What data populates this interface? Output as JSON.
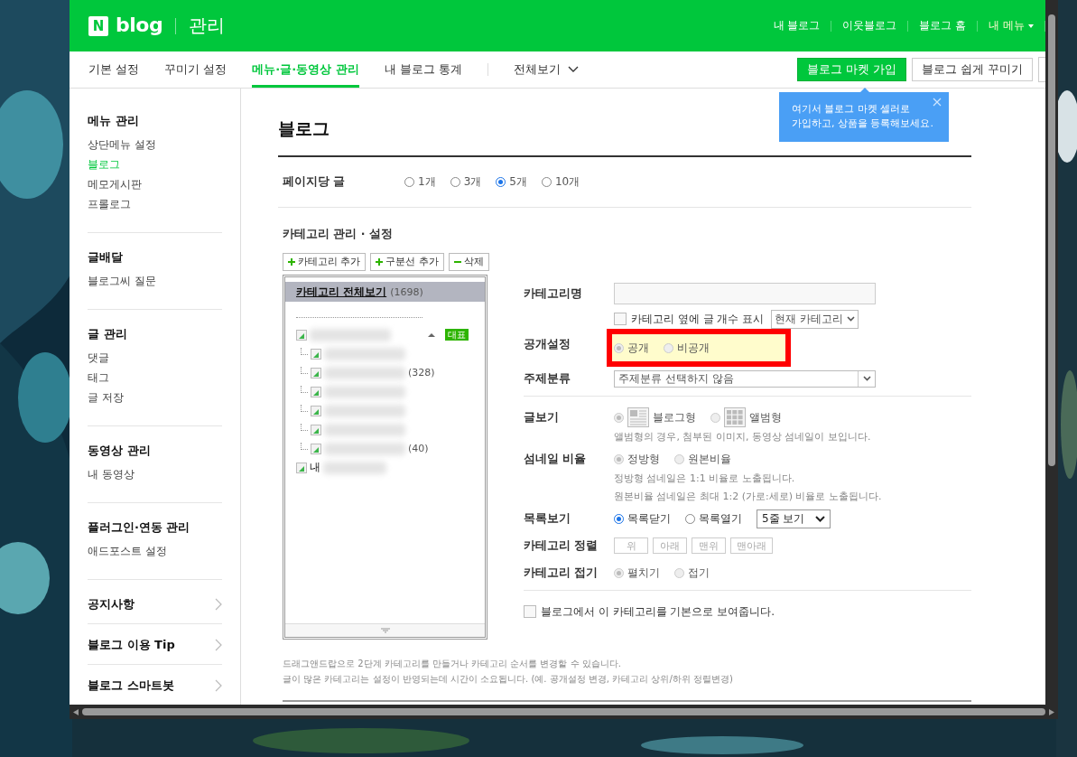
{
  "header": {
    "logo_mark": "N",
    "logo_text": "blog",
    "title": "관리",
    "links": [
      {
        "label": "내 블로그",
        "kind": "link"
      },
      {
        "label": "이웃블로그",
        "kind": "link"
      },
      {
        "label": "블로그 홈",
        "kind": "link"
      },
      {
        "label": "내 메뉴",
        "kind": "menu"
      }
    ]
  },
  "tabs": [
    {
      "label": "기본 설정",
      "selected": false,
      "kind": "tab"
    },
    {
      "label": "꾸미기 설정",
      "selected": false,
      "kind": "tab"
    },
    {
      "label": "메뉴·글·동영상 관리",
      "selected": true,
      "kind": "tab"
    },
    {
      "label": "내 블로그 통계",
      "selected": false,
      "kind": "tab"
    },
    {
      "label": "전체보기",
      "selected": false,
      "kind": "dropdown"
    }
  ],
  "actions": [
    {
      "label": "블로그 마켓 가입",
      "kind": "primary"
    },
    {
      "label": "블로그 쉽게 꾸미기",
      "kind": "outline"
    }
  ],
  "tooltip": {
    "lines": [
      "여기서 블로그 마켓 셀러로",
      "가입하고, 상품을 등록해보세요."
    ]
  },
  "sidebar": {
    "sections": [
      {
        "title": "메뉴 관리",
        "items": [
          {
            "label": "상단메뉴 설정",
            "selected": false
          },
          {
            "label": "블로그",
            "selected": true
          },
          {
            "label": "메모게시판",
            "selected": false
          },
          {
            "label": "프롤로그",
            "selected": false
          }
        ]
      },
      {
        "title": "글배달",
        "items": [
          {
            "label": "블로그씨 질문",
            "selected": false
          }
        ]
      },
      {
        "title": "글 관리",
        "items": [
          {
            "label": "댓글",
            "selected": false
          },
          {
            "label": "태그",
            "selected": false
          },
          {
            "label": "글 저장",
            "selected": false
          }
        ]
      },
      {
        "title": "동영상 관리",
        "items": [
          {
            "label": "내 동영상",
            "selected": false
          }
        ]
      },
      {
        "title": "플러그인·연동 관리",
        "items": [
          {
            "label": "애드포스트 설정",
            "selected": false
          }
        ]
      },
      {
        "title": "공지사항",
        "kind": "link"
      },
      {
        "title": "블로그 이용 Tip",
        "kind": "link"
      },
      {
        "title": "블로그 스마트봇",
        "kind": "link"
      }
    ]
  },
  "main": {
    "title": "블로그",
    "per_page": {
      "label": "페이지당 글",
      "options": [
        {
          "label": "1개",
          "selected": false
        },
        {
          "label": "3개",
          "selected": false
        },
        {
          "label": "5개",
          "selected": true
        },
        {
          "label": "10개",
          "selected": false
        }
      ]
    },
    "category": {
      "title": "카테고리 관리 · 설정",
      "buttons": [
        {
          "label": "카테고리 추가",
          "kind": "add"
        },
        {
          "label": "구분선 추가",
          "kind": "add"
        },
        {
          "label": "삭제",
          "kind": "remove"
        }
      ],
      "tree": {
        "root_label": "카테고리 전체보기",
        "root_count": "(1698)",
        "items": [
          {
            "kind": "blurred",
            "badge": "대표",
            "expanded": true,
            "children": [
              {
                "kind": "blurred"
              },
              {
                "kind": "blurred",
                "count": "(328)"
              },
              {
                "kind": "blurred"
              },
              {
                "kind": "blurred"
              },
              {
                "kind": "blurred"
              },
              {
                "kind": "blurred",
                "count": "(40)"
              }
            ]
          },
          {
            "kind": "partly_blurred",
            "label": "내"
          }
        ]
      }
    },
    "form": [
      {
        "kind": "input",
        "label": "카테고리명"
      },
      {
        "kind": "checkbox",
        "label": "카테고리 옆에 글 개수 표시",
        "checked": false,
        "select": "현재 카테고리"
      },
      {
        "kind": "radio",
        "label": "공개설정",
        "disabled": true,
        "highlighted": true,
        "options": [
          {
            "label": "공개",
            "selected": true
          },
          {
            "label": "비공개",
            "selected": false
          }
        ]
      },
      {
        "kind": "select",
        "label": "주제분류",
        "value": "주제분류 선택하지 않음"
      },
      {
        "kind": "divider"
      },
      {
        "kind": "radio",
        "label": "글보기",
        "disabled": true,
        "options": [
          {
            "label": "블로그형",
            "selected": true,
            "kind": "list_layout"
          },
          {
            "label": "앨범형",
            "selected": false,
            "kind": "grid_layout"
          }
        ],
        "notes": [
          "앨범형의 경우, 첨부된 이미지, 동영상 섬네일이 보입니다."
        ]
      },
      {
        "kind": "radio",
        "label": "섬네일 비율",
        "disabled": true,
        "options": [
          {
            "label": "정방형",
            "selected": true
          },
          {
            "label": "원본비율",
            "selected": false
          }
        ],
        "notes": [
          "정방형 섬네일은 1:1 비율로 노출됩니다.",
          "원본비율 섬네일은 최대 1:2 (가로:세로) 비율로 노출됩니다."
        ]
      },
      {
        "kind": "radio",
        "label": "목록보기",
        "disabled": false,
        "options": [
          {
            "label": "목록닫기",
            "selected": true
          },
          {
            "label": "목록열기",
            "selected": false
          }
        ],
        "select": "5줄 보기"
      },
      {
        "kind": "buttons",
        "label": "카테고리 정렬",
        "disabled": true,
        "buttons": [
          "위",
          "아래",
          "맨위",
          "맨아래"
        ]
      },
      {
        "kind": "radio",
        "label": "카테고리 접기",
        "disabled": true,
        "options": [
          {
            "label": "펼치기",
            "selected": true
          },
          {
            "label": "접기",
            "selected": false
          }
        ]
      },
      {
        "kind": "divider"
      },
      {
        "kind": "checkbox",
        "label": "블로그에서 이 카테고리를 기본으로 보여줍니다.",
        "checked": false
      }
    ],
    "notes": [
      "드래그앤드랍으로 2단계 카테고리를 만들거나 카테고리 순서를 변경할 수 있습니다.",
      "글이 많은 카테고리는 설정이 반영되는데 시간이 소요됩니다. (예. 공개설정 변경, 카테고리 상위/하위 정렬변경)"
    ]
  }
}
